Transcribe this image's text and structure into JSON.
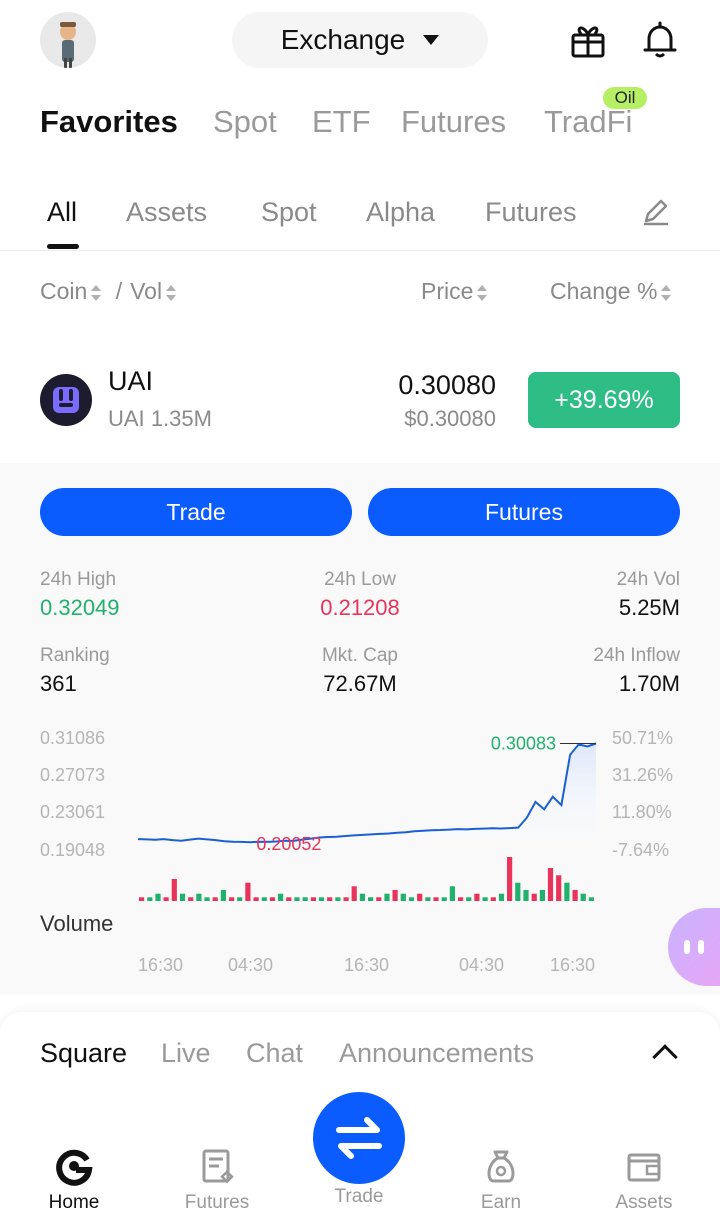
{
  "header": {
    "exchange_label": "Exchange",
    "icons": [
      "avatar",
      "gift-icon",
      "bell-icon"
    ]
  },
  "primary_tabs": [
    {
      "label": "Favorites",
      "active": true
    },
    {
      "label": "Spot"
    },
    {
      "label": "ETF"
    },
    {
      "label": "Futures"
    },
    {
      "label": "TradFi",
      "badge": "Oil"
    }
  ],
  "secondary_tabs": [
    {
      "label": "All",
      "active": true
    },
    {
      "label": "Assets"
    },
    {
      "label": "Spot"
    },
    {
      "label": "Alpha"
    },
    {
      "label": "Futures"
    }
  ],
  "columns": {
    "coin": "Coin",
    "slash": "/",
    "vol": "Vol",
    "price": "Price",
    "change": "Change %"
  },
  "coin": {
    "symbol": "UAI",
    "pair": "UAI",
    "volume": "1.35M",
    "price": "0.30080",
    "price_usd": "$0.30080",
    "change": "+39.69%"
  },
  "actions": {
    "trade": "Trade",
    "futures": "Futures"
  },
  "stats": {
    "high_label": "24h High",
    "high": "0.32049",
    "low_label": "24h Low",
    "low": "0.21208",
    "vol_label": "24h Vol",
    "vol": "5.25M",
    "rank_label": "Ranking",
    "rank": "361",
    "cap_label": "Mkt. Cap",
    "cap": "72.67M",
    "inflow_label": "24h Inflow",
    "inflow": "1.70M"
  },
  "chart": {
    "y_left": [
      "0.31086",
      "0.27073",
      "0.23061",
      "0.19048"
    ],
    "y_right": [
      "50.71%",
      "31.26%",
      "11.80%",
      "-7.64%"
    ],
    "high_marker": "0.30083",
    "low_marker": "0.20052",
    "volume_label": "Volume",
    "x_ticks": [
      "16:30",
      "04:30",
      "16:30",
      "04:30",
      "16:30"
    ]
  },
  "chart_data": {
    "type": "line",
    "title": "",
    "ylim": [
      0.19048,
      0.31086
    ],
    "y": [
      0.2095,
      0.2092,
      0.2088,
      0.2095,
      0.2085,
      0.208,
      0.209,
      0.21,
      0.2092,
      0.2085,
      0.2075,
      0.207,
      0.2068,
      0.2065,
      0.207,
      0.2068,
      0.2072,
      0.208,
      0.2078,
      0.209,
      0.21,
      0.211,
      0.2115,
      0.2118,
      0.2125,
      0.213,
      0.2135,
      0.214,
      0.2145,
      0.2148,
      0.2155,
      0.216,
      0.217,
      0.2175,
      0.218,
      0.2182,
      0.2186,
      0.219,
      0.2188,
      0.2192,
      0.2195,
      0.2198,
      0.2196,
      0.22,
      0.2205,
      0.23,
      0.245,
      0.238,
      0.25,
      0.242,
      0.29,
      0.3,
      0.298,
      0.3008
    ],
    "volume": [
      1,
      1,
      2,
      1,
      6,
      2,
      1,
      2,
      1,
      1,
      3,
      1,
      1,
      5,
      1,
      1,
      1,
      2,
      1,
      1,
      1,
      1,
      1,
      1,
      1,
      1,
      4,
      2,
      1,
      1,
      2,
      3,
      2,
      1,
      2,
      1,
      1,
      1,
      4,
      1,
      1,
      2,
      1,
      1,
      2,
      12,
      5,
      3,
      2,
      3,
      9,
      7,
      5,
      3,
      2,
      1
    ],
    "volume_up": [
      0,
      1,
      1,
      0,
      0,
      1,
      0,
      1,
      1,
      0,
      1,
      0,
      1,
      0,
      0,
      1,
      0,
      1,
      0,
      1,
      1,
      0,
      1,
      0,
      1,
      0,
      0,
      1,
      1,
      0,
      1,
      0,
      1,
      1,
      0,
      1,
      0,
      1,
      1,
      0,
      1,
      0,
      1,
      0,
      1,
      0,
      1,
      1,
      0,
      1,
      0,
      0,
      1,
      0,
      1,
      1
    ],
    "up_color": "#20b26c",
    "down_color": "#e8345a",
    "line_color": "#1a5fd4"
  },
  "square_tabs": [
    {
      "label": "Square",
      "active": true
    },
    {
      "label": "Live"
    },
    {
      "label": "Chat"
    },
    {
      "label": "Announcements"
    }
  ],
  "nav": {
    "home": "Home",
    "futures": "Futures",
    "trade": "Trade",
    "earn": "Earn",
    "assets": "Assets"
  },
  "colors": {
    "accent": "#0a5cff",
    "up": "#2ebd85",
    "down": "#e8345a"
  }
}
